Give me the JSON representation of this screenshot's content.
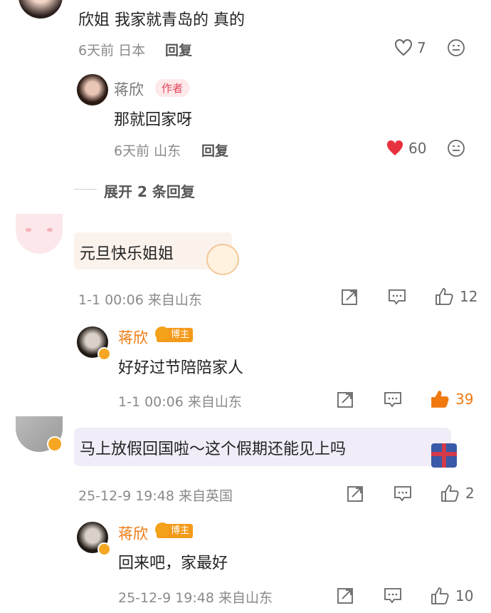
{
  "colors": {
    "accent_orange": "#f07a10",
    "heart_red": "#e8313f",
    "author_pink": "#e0475a"
  },
  "comments": [
    {
      "text": "欣姐 我家就青岛的 真的",
      "meta": "6天前 日本",
      "reply_label": "回复",
      "likes": "7",
      "replies": [
        {
          "name": "蒋欣",
          "badge": "作者",
          "text": "那就回家呀",
          "meta": "6天前 山东",
          "reply_label": "回复",
          "likes": "60"
        }
      ],
      "expand_label": "展开 2 条回复"
    },
    {
      "text": "元旦快乐姐姐",
      "meta": "1-1 00:06 来自山东",
      "likes": "12",
      "replies": [
        {
          "name": "蒋欣",
          "badge": "博主",
          "text": "好好过节陪陪家人",
          "meta": "1-1 00:06 来自山东",
          "likes": "39"
        }
      ]
    },
    {
      "text": "马上放假回国啦～这个假期还能见上吗",
      "meta": "25-12-9 19:48 来自英国",
      "likes": "2",
      "replies": [
        {
          "name": "蒋欣",
          "badge": "博主",
          "text": "回来吧，家最好",
          "meta": "25-12-9 19:48 来自山东",
          "likes": "10"
        }
      ]
    }
  ]
}
